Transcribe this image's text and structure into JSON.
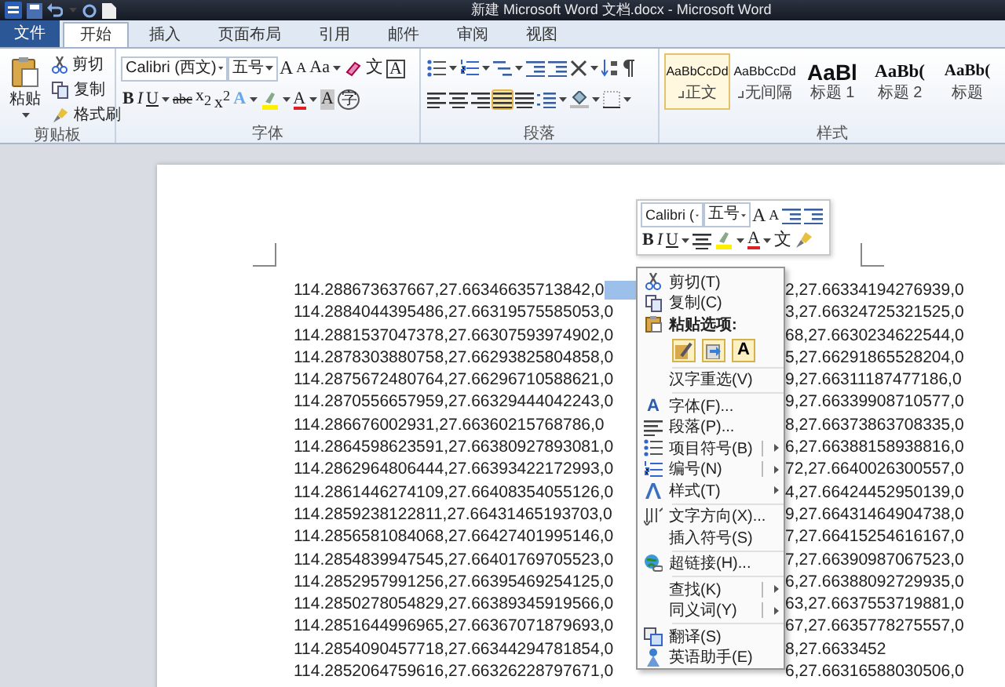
{
  "window": {
    "title": "新建 Microsoft Word 文档.docx - Microsoft Word"
  },
  "tabs": [
    {
      "label": "文件",
      "kind": "file",
      "selected": false
    },
    {
      "label": "开始",
      "kind": "tab",
      "selected": true
    },
    {
      "label": "插入",
      "kind": "tab",
      "selected": false
    },
    {
      "label": "页面布局",
      "kind": "tab",
      "selected": false
    },
    {
      "label": "引用",
      "kind": "tab",
      "selected": false
    },
    {
      "label": "邮件",
      "kind": "tab",
      "selected": false
    },
    {
      "label": "审阅",
      "kind": "tab",
      "selected": false
    },
    {
      "label": "视图",
      "kind": "tab",
      "selected": false
    }
  ],
  "clipboard": {
    "paste": "粘贴",
    "commands": [
      "剪切",
      "复制",
      "格式刷"
    ],
    "label": "剪贴板"
  },
  "font": {
    "name": "Calibri (西文)",
    "size": "五号",
    "row1": [
      {
        "kind": "grow",
        "glyph": "A"
      },
      {
        "kind": "shrink",
        "glyph": "A"
      },
      {
        "kind": "case",
        "glyph": "Aa"
      },
      {
        "kind": "clear"
      },
      {
        "kind": "phonetic",
        "glyph": "文"
      },
      {
        "kind": "border",
        "glyph": "A"
      }
    ],
    "row2": [
      {
        "kind": "bold",
        "glyph": "B"
      },
      {
        "kind": "italic",
        "glyph": "I"
      },
      {
        "kind": "underline",
        "glyph": "U"
      },
      {
        "kind": "strike",
        "glyph": "abc"
      },
      {
        "kind": "sub",
        "glyph": "x$_{2}$"
      },
      {
        "kind": "sup",
        "glyph": "x$^{2}$"
      },
      {
        "kind": "effects",
        "glyph": "A"
      },
      {
        "kind": "highlight"
      },
      {
        "kind": "color",
        "glyph": "A"
      },
      {
        "kind": "shading",
        "glyph": "A"
      },
      {
        "kind": "enclose",
        "glyph": "字"
      }
    ],
    "label": "字体"
  },
  "paragraph": {
    "alignment": [
      {
        "kind": "left",
        "selected": false
      },
      {
        "kind": "center",
        "selected": false
      },
      {
        "kind": "right",
        "selected": false
      },
      {
        "kind": "justify",
        "selected": true
      },
      {
        "kind": "distributed",
        "selected": false
      }
    ],
    "label": "段落"
  },
  "styles": {
    "items": [
      {
        "preview": "AaBbCcDd",
        "name": "正文",
        "kind": "normal",
        "selected": true
      },
      {
        "preview": "AaBbCcDd",
        "name": "无间隔",
        "kind": "nospacing",
        "selected": false
      },
      {
        "preview": "AaBl",
        "name": "标题 1",
        "kind": "heading1",
        "selected": false
      },
      {
        "preview": "AaBb(",
        "name": "标题 2",
        "kind": "heading2",
        "selected": false
      },
      {
        "preview": "AaBb(",
        "name": "标题",
        "kind": "title",
        "selected": false
      }
    ],
    "label": "样式"
  },
  "mini_toolbar": {
    "font": "Calibri (",
    "size": "五号",
    "row1": [
      {
        "kind": "grow",
        "glyph": "A"
      },
      {
        "kind": "shrink",
        "glyph": "A"
      },
      {
        "kind": "outdent"
      },
      {
        "kind": "indent"
      }
    ],
    "row2": [
      {
        "kind": "bold",
        "glyph": "B"
      },
      {
        "kind": "italic",
        "glyph": "I"
      },
      {
        "kind": "underline",
        "glyph": "U"
      },
      {
        "kind": "center"
      },
      {
        "kind": "highlight"
      },
      {
        "kind": "color",
        "glyph": "A"
      },
      {
        "kind": "phonetic",
        "glyph": "文"
      },
      {
        "kind": "painter"
      }
    ]
  },
  "document": {
    "lines": [
      {
        "text": "114.288673637667,27.66346635713842,0",
        "continuation": "2,27.66334194276939,0",
        "selected": true
      },
      {
        "text": "114.2884044395486,27.66319575585053,0",
        "continuation": "3,27.66324725321525,0",
        "selected": false
      },
      {
        "text": "114.2881537047378,27.66307593974902,0",
        "continuation": "68,27.6630234622544,0",
        "selected": false
      },
      {
        "text": "114.2878303880758,27.66293825804858,0",
        "continuation": "5,27.66291865528204,0",
        "selected": false
      },
      {
        "text": "114.2875672480764,27.66296710588621,0",
        "continuation": "9,27.66311187477186,0",
        "selected": false
      },
      {
        "text": "114.2870556657959,27.66329444042243,0",
        "continuation": "9,27.66339908710577,0",
        "selected": false
      },
      {
        "text": "114.286676002931,27.66360215768786,0",
        "continuation": "8,27.66373863708335,0",
        "selected": false
      },
      {
        "text": "114.2864598623591,27.66380927893081,0",
        "continuation": "6,27.66388158938816,0",
        "selected": false
      },
      {
        "text": "114.2862964806444,27.66393422172993,0",
        "continuation": "72,27.6640026300557,0",
        "selected": false
      },
      {
        "text": "114.2861446274109,27.66408354055126,0",
        "continuation": "4,27.66424452950139,0",
        "selected": false
      },
      {
        "text": "114.2859238122811,27.66431465193703,0",
        "continuation": "9,27.66431464904738,0",
        "selected": false
      },
      {
        "text": "114.2856581084068,27.66427401995146,0",
        "continuation": "7,27.66415254616167,0",
        "selected": false
      },
      {
        "text": "114.2854839947545,27.66401769705523,0",
        "continuation": "7,27.66390987067523,0",
        "selected": false
      },
      {
        "text": "114.2852957991256,27.66395469254125,0",
        "continuation": "6,27.66388092729935,0",
        "selected": false
      },
      {
        "text": "114.2850278054829,27.66389345919566,0",
        "continuation": "63,27.6637553719881,0",
        "selected": false
      },
      {
        "text": "114.2851644996965,27.66367071879693,0",
        "continuation": "67,27.6635778275557,0",
        "selected": false
      },
      {
        "text": "114.2854090457718,27.66344294781854,0",
        "continuation": "8,27.6633452",
        "selected": false
      },
      {
        "text": "114.2852064759616,27.66326228797671,0",
        "continuation": "6,27.66316588030506,0",
        "selected": false
      }
    ]
  },
  "context_menu": {
    "items": [
      {
        "kind": "command",
        "label": "剪切(T)"
      },
      {
        "kind": "command",
        "label": "复制(C)"
      },
      {
        "kind": "heading",
        "label": "粘贴选项:"
      },
      {
        "kind": "paste_options",
        "options": [
          {
            "kind": "keep"
          },
          {
            "kind": "merge"
          },
          {
            "kind": "text",
            "glyph": "A"
          }
        ]
      },
      {
        "kind": "separator"
      },
      {
        "kind": "command",
        "label": "汉字重选(V)"
      },
      {
        "kind": "separator"
      },
      {
        "kind": "command",
        "label": "字体(F)...",
        "glyph": "A"
      },
      {
        "kind": "command",
        "label": "段落(P)..."
      },
      {
        "kind": "split",
        "label": "项目符号(B)"
      },
      {
        "kind": "split",
        "label": "编号(N)"
      },
      {
        "kind": "submenu",
        "label": "样式(T)"
      },
      {
        "kind": "separator"
      },
      {
        "kind": "command",
        "label": "文字方向(X)..."
      },
      {
        "kind": "command",
        "label": "插入符号(S)"
      },
      {
        "kind": "separator"
      },
      {
        "kind": "command",
        "label": "超链接(H)..."
      },
      {
        "kind": "separator"
      },
      {
        "kind": "split",
        "label": "查找(K)"
      },
      {
        "kind": "split",
        "label": "同义词(Y)"
      },
      {
        "kind": "separator"
      },
      {
        "kind": "command",
        "label": "翻译(S)"
      },
      {
        "kind": "command",
        "label": "英语助手(E)"
      }
    ]
  }
}
